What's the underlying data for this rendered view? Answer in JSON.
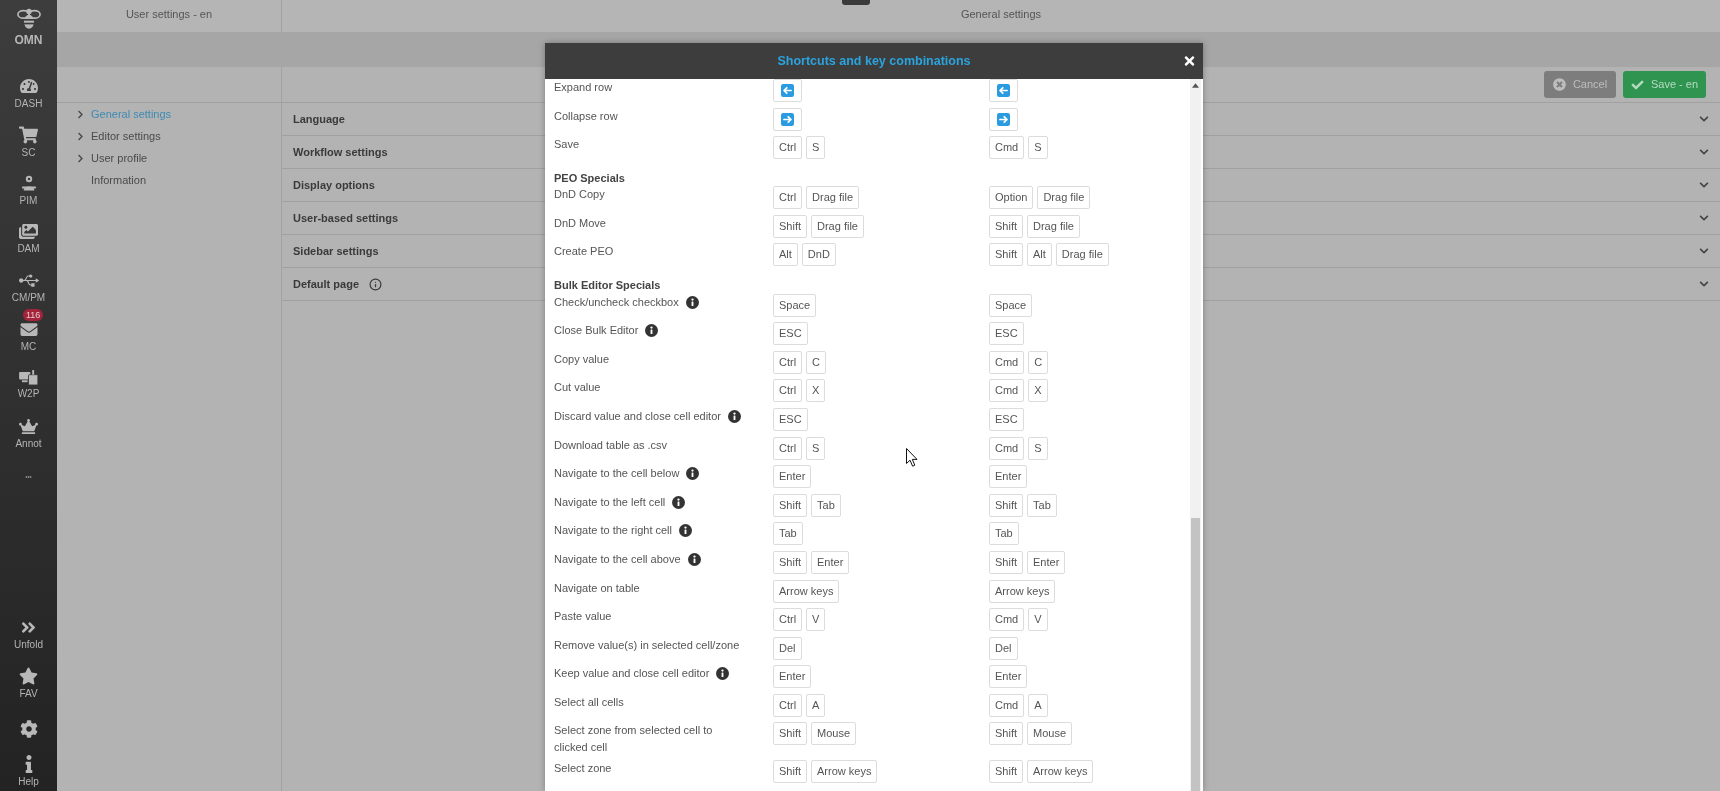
{
  "sidebar": {
    "logo_text": "OMN",
    "items": [
      {
        "label": "DASH"
      },
      {
        "label": "SC"
      },
      {
        "label": "PIM"
      },
      {
        "label": "DAM"
      },
      {
        "label": "CM/PM"
      },
      {
        "label": "MC",
        "badge": "116"
      },
      {
        "label": "W2P"
      },
      {
        "label": "Annot"
      }
    ],
    "bottom_items": [
      {
        "label": "Unfold"
      },
      {
        "label": "FAV"
      },
      {
        "label": "Help"
      }
    ]
  },
  "settings_nav": {
    "title": "User settings - en",
    "items": [
      {
        "label": "General settings",
        "selected": true,
        "expandable": true
      },
      {
        "label": "Editor settings",
        "selected": false,
        "expandable": true
      },
      {
        "label": "User profile",
        "selected": false,
        "expandable": true
      },
      {
        "label": "Information",
        "selected": false,
        "expandable": false
      }
    ]
  },
  "page": {
    "title": "General settings",
    "buttons": [
      {
        "kind": "cancel",
        "label": "Cancel"
      },
      {
        "kind": "save",
        "label": "Save - en"
      }
    ],
    "sections": [
      {
        "label": "Language",
        "info": false,
        "expanded": false
      },
      {
        "label": "Workflow settings",
        "info": false,
        "expanded": false
      },
      {
        "label": "Display options",
        "info": false,
        "expanded": false
      },
      {
        "label": "User-based settings",
        "info": false,
        "expanded": false
      },
      {
        "label": "Sidebar settings",
        "info": false,
        "expanded": false
      },
      {
        "label": "Default page",
        "info": true,
        "expanded": false
      }
    ]
  },
  "dialog": {
    "title": "Shortcuts and key combinations",
    "rows": [
      {
        "kind": "shortcut",
        "label": "Expand row",
        "info": false,
        "column_2": [
          {
            "kind": "arrow_left"
          }
        ],
        "column_3": [
          {
            "kind": "arrow_left"
          }
        ]
      },
      {
        "kind": "shortcut",
        "label": "Collapse row",
        "info": false,
        "column_2": [
          {
            "kind": "arrow_right"
          }
        ],
        "column_3": [
          {
            "kind": "arrow_right"
          }
        ]
      },
      {
        "kind": "shortcut",
        "label": "Save",
        "info": false,
        "column_2": [
          "Ctrl",
          "S"
        ],
        "column_3": [
          "Cmd",
          "S"
        ]
      },
      {
        "kind": "heading",
        "label": "PEO Specials"
      },
      {
        "kind": "shortcut",
        "label": "DnD Copy",
        "info": false,
        "column_2": [
          "Ctrl",
          "Drag file"
        ],
        "column_3": [
          "Option",
          "Drag file"
        ]
      },
      {
        "kind": "shortcut",
        "label": "DnD Move",
        "info": false,
        "column_2": [
          "Shift",
          "Drag file"
        ],
        "column_3": [
          "Shift",
          "Drag file"
        ]
      },
      {
        "kind": "shortcut",
        "label": "Create PEO",
        "info": false,
        "column_2": [
          "Alt",
          "DnD"
        ],
        "column_3": [
          "Shift",
          "Alt",
          "Drag file"
        ]
      },
      {
        "kind": "heading",
        "label": "Bulk Editor Specials"
      },
      {
        "kind": "shortcut",
        "label": "Check/uncheck checkbox",
        "info": true,
        "column_2": [
          "Space"
        ],
        "column_3": [
          "Space"
        ]
      },
      {
        "kind": "shortcut",
        "label": "Close Bulk Editor",
        "info": true,
        "column_2": [
          "ESC"
        ],
        "column_3": [
          "ESC"
        ]
      },
      {
        "kind": "shortcut",
        "label": "Copy value",
        "info": false,
        "column_2": [
          "Ctrl",
          "C"
        ],
        "column_3": [
          "Cmd",
          "C"
        ]
      },
      {
        "kind": "shortcut",
        "label": "Cut value",
        "info": false,
        "column_2": [
          "Ctrl",
          "X"
        ],
        "column_3": [
          "Cmd",
          "X"
        ]
      },
      {
        "kind": "shortcut",
        "label": "Discard value and close cell editor",
        "info": true,
        "column_2": [
          "ESC"
        ],
        "column_3": [
          "ESC"
        ]
      },
      {
        "kind": "shortcut",
        "label": "Download table as .csv",
        "info": false,
        "column_2": [
          "Ctrl",
          "S"
        ],
        "column_3": [
          "Cmd",
          "S"
        ]
      },
      {
        "kind": "shortcut",
        "label": "Navigate to the cell below",
        "info": true,
        "column_2": [
          "Enter"
        ],
        "column_3": [
          "Enter"
        ]
      },
      {
        "kind": "shortcut",
        "label": "Navigate to the left cell",
        "info": true,
        "column_2": [
          "Shift",
          "Tab"
        ],
        "column_3": [
          "Shift",
          "Tab"
        ]
      },
      {
        "kind": "shortcut",
        "label": "Navigate to the right cell",
        "info": true,
        "column_2": [
          "Tab"
        ],
        "column_3": [
          "Tab"
        ]
      },
      {
        "kind": "shortcut",
        "label": "Navigate to the cell above",
        "info": true,
        "column_2": [
          "Shift",
          "Enter"
        ],
        "column_3": [
          "Shift",
          "Enter"
        ]
      },
      {
        "kind": "shortcut",
        "label": "Navigate on table",
        "info": false,
        "column_2": [
          "Arrow keys"
        ],
        "column_3": [
          "Arrow keys"
        ]
      },
      {
        "kind": "shortcut",
        "label": "Paste value",
        "info": false,
        "column_2": [
          "Ctrl",
          "V"
        ],
        "column_3": [
          "Cmd",
          "V"
        ]
      },
      {
        "kind": "shortcut",
        "label": "Remove value(s) in selected cell/zone",
        "info": false,
        "column_2": [
          "Del"
        ],
        "column_3": [
          "Del"
        ]
      },
      {
        "kind": "shortcut",
        "label": "Keep value and close cell editor",
        "info": true,
        "column_2": [
          "Enter"
        ],
        "column_3": [
          "Enter"
        ]
      },
      {
        "kind": "shortcut",
        "label": "Select all cells",
        "info": false,
        "column_2": [
          "Ctrl",
          "A"
        ],
        "column_3": [
          "Cmd",
          "A"
        ]
      },
      {
        "kind": "shortcut",
        "label": "Select zone from selected cell to clicked cell",
        "info": false,
        "column_2": [
          "Shift",
          "Mouse"
        ],
        "column_3": [
          "Shift",
          "Mouse"
        ]
      },
      {
        "kind": "shortcut",
        "label": "Select zone",
        "info": false,
        "column_2": [
          "Shift",
          "Arrow keys"
        ],
        "column_3": [
          "Shift",
          "Arrow keys"
        ]
      }
    ]
  }
}
